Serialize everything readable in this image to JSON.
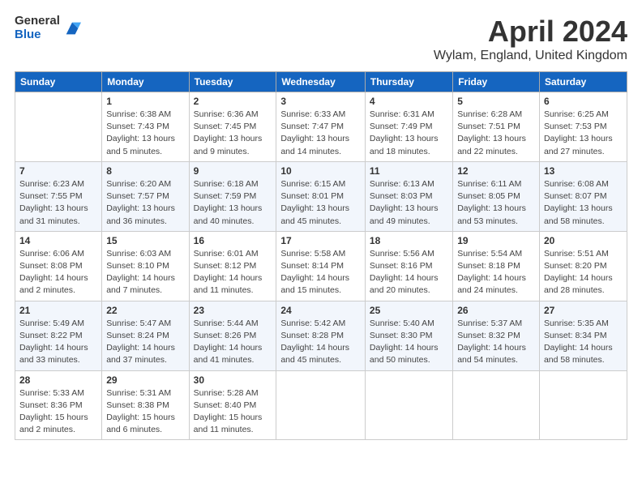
{
  "logo": {
    "general": "General",
    "blue": "Blue"
  },
  "title": "April 2024",
  "subtitle": "Wylam, England, United Kingdom",
  "days_of_week": [
    "Sunday",
    "Monday",
    "Tuesday",
    "Wednesday",
    "Thursday",
    "Friday",
    "Saturday"
  ],
  "weeks": [
    [
      {
        "day": "",
        "info": ""
      },
      {
        "day": "1",
        "info": "Sunrise: 6:38 AM\nSunset: 7:43 PM\nDaylight: 13 hours\nand 5 minutes."
      },
      {
        "day": "2",
        "info": "Sunrise: 6:36 AM\nSunset: 7:45 PM\nDaylight: 13 hours\nand 9 minutes."
      },
      {
        "day": "3",
        "info": "Sunrise: 6:33 AM\nSunset: 7:47 PM\nDaylight: 13 hours\nand 14 minutes."
      },
      {
        "day": "4",
        "info": "Sunrise: 6:31 AM\nSunset: 7:49 PM\nDaylight: 13 hours\nand 18 minutes."
      },
      {
        "day": "5",
        "info": "Sunrise: 6:28 AM\nSunset: 7:51 PM\nDaylight: 13 hours\nand 22 minutes."
      },
      {
        "day": "6",
        "info": "Sunrise: 6:25 AM\nSunset: 7:53 PM\nDaylight: 13 hours\nand 27 minutes."
      }
    ],
    [
      {
        "day": "7",
        "info": "Sunrise: 6:23 AM\nSunset: 7:55 PM\nDaylight: 13 hours\nand 31 minutes."
      },
      {
        "day": "8",
        "info": "Sunrise: 6:20 AM\nSunset: 7:57 PM\nDaylight: 13 hours\nand 36 minutes."
      },
      {
        "day": "9",
        "info": "Sunrise: 6:18 AM\nSunset: 7:59 PM\nDaylight: 13 hours\nand 40 minutes."
      },
      {
        "day": "10",
        "info": "Sunrise: 6:15 AM\nSunset: 8:01 PM\nDaylight: 13 hours\nand 45 minutes."
      },
      {
        "day": "11",
        "info": "Sunrise: 6:13 AM\nSunset: 8:03 PM\nDaylight: 13 hours\nand 49 minutes."
      },
      {
        "day": "12",
        "info": "Sunrise: 6:11 AM\nSunset: 8:05 PM\nDaylight: 13 hours\nand 53 minutes."
      },
      {
        "day": "13",
        "info": "Sunrise: 6:08 AM\nSunset: 8:07 PM\nDaylight: 13 hours\nand 58 minutes."
      }
    ],
    [
      {
        "day": "14",
        "info": "Sunrise: 6:06 AM\nSunset: 8:08 PM\nDaylight: 14 hours\nand 2 minutes."
      },
      {
        "day": "15",
        "info": "Sunrise: 6:03 AM\nSunset: 8:10 PM\nDaylight: 14 hours\nand 7 minutes."
      },
      {
        "day": "16",
        "info": "Sunrise: 6:01 AM\nSunset: 8:12 PM\nDaylight: 14 hours\nand 11 minutes."
      },
      {
        "day": "17",
        "info": "Sunrise: 5:58 AM\nSunset: 8:14 PM\nDaylight: 14 hours\nand 15 minutes."
      },
      {
        "day": "18",
        "info": "Sunrise: 5:56 AM\nSunset: 8:16 PM\nDaylight: 14 hours\nand 20 minutes."
      },
      {
        "day": "19",
        "info": "Sunrise: 5:54 AM\nSunset: 8:18 PM\nDaylight: 14 hours\nand 24 minutes."
      },
      {
        "day": "20",
        "info": "Sunrise: 5:51 AM\nSunset: 8:20 PM\nDaylight: 14 hours\nand 28 minutes."
      }
    ],
    [
      {
        "day": "21",
        "info": "Sunrise: 5:49 AM\nSunset: 8:22 PM\nDaylight: 14 hours\nand 33 minutes."
      },
      {
        "day": "22",
        "info": "Sunrise: 5:47 AM\nSunset: 8:24 PM\nDaylight: 14 hours\nand 37 minutes."
      },
      {
        "day": "23",
        "info": "Sunrise: 5:44 AM\nSunset: 8:26 PM\nDaylight: 14 hours\nand 41 minutes."
      },
      {
        "day": "24",
        "info": "Sunrise: 5:42 AM\nSunset: 8:28 PM\nDaylight: 14 hours\nand 45 minutes."
      },
      {
        "day": "25",
        "info": "Sunrise: 5:40 AM\nSunset: 8:30 PM\nDaylight: 14 hours\nand 50 minutes."
      },
      {
        "day": "26",
        "info": "Sunrise: 5:37 AM\nSunset: 8:32 PM\nDaylight: 14 hours\nand 54 minutes."
      },
      {
        "day": "27",
        "info": "Sunrise: 5:35 AM\nSunset: 8:34 PM\nDaylight: 14 hours\nand 58 minutes."
      }
    ],
    [
      {
        "day": "28",
        "info": "Sunrise: 5:33 AM\nSunset: 8:36 PM\nDaylight: 15 hours\nand 2 minutes."
      },
      {
        "day": "29",
        "info": "Sunrise: 5:31 AM\nSunset: 8:38 PM\nDaylight: 15 hours\nand 6 minutes."
      },
      {
        "day": "30",
        "info": "Sunrise: 5:28 AM\nSunset: 8:40 PM\nDaylight: 15 hours\nand 11 minutes."
      },
      {
        "day": "",
        "info": ""
      },
      {
        "day": "",
        "info": ""
      },
      {
        "day": "",
        "info": ""
      },
      {
        "day": "",
        "info": ""
      }
    ]
  ]
}
